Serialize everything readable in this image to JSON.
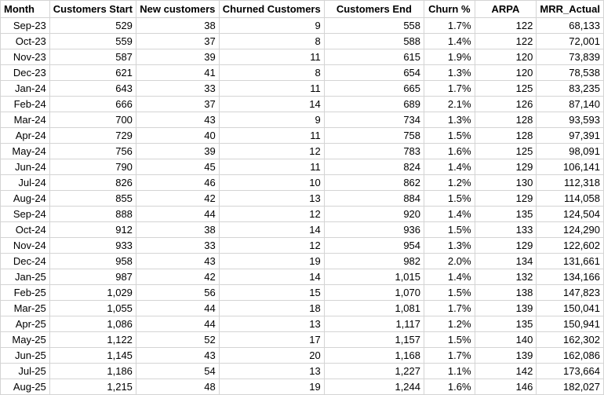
{
  "table": {
    "headers": [
      "Month",
      "Customers Start",
      "New customers",
      "Churned Customers",
      "Customers End",
      "Churn %",
      "ARPA",
      "MRR_Actual"
    ],
    "rows": [
      [
        "Sep-23",
        "529",
        "38",
        "9",
        "558",
        "1.7%",
        "122",
        "68,133"
      ],
      [
        "Oct-23",
        "559",
        "37",
        "8",
        "588",
        "1.4%",
        "122",
        "72,001"
      ],
      [
        "Nov-23",
        "587",
        "39",
        "11",
        "615",
        "1.9%",
        "120",
        "73,839"
      ],
      [
        "Dec-23",
        "621",
        "41",
        "8",
        "654",
        "1.3%",
        "120",
        "78,538"
      ],
      [
        "Jan-24",
        "643",
        "33",
        "11",
        "665",
        "1.7%",
        "125",
        "83,235"
      ],
      [
        "Feb-24",
        "666",
        "37",
        "14",
        "689",
        "2.1%",
        "126",
        "87,140"
      ],
      [
        "Mar-24",
        "700",
        "43",
        "9",
        "734",
        "1.3%",
        "128",
        "93,593"
      ],
      [
        "Apr-24",
        "729",
        "40",
        "11",
        "758",
        "1.5%",
        "128",
        "97,391"
      ],
      [
        "May-24",
        "756",
        "39",
        "12",
        "783",
        "1.6%",
        "125",
        "98,091"
      ],
      [
        "Jun-24",
        "790",
        "45",
        "11",
        "824",
        "1.4%",
        "129",
        "106,141"
      ],
      [
        "Jul-24",
        "826",
        "46",
        "10",
        "862",
        "1.2%",
        "130",
        "112,318"
      ],
      [
        "Aug-24",
        "855",
        "42",
        "13",
        "884",
        "1.5%",
        "129",
        "114,058"
      ],
      [
        "Sep-24",
        "888",
        "44",
        "12",
        "920",
        "1.4%",
        "135",
        "124,504"
      ],
      [
        "Oct-24",
        "912",
        "38",
        "14",
        "936",
        "1.5%",
        "133",
        "124,290"
      ],
      [
        "Nov-24",
        "933",
        "33",
        "12",
        "954",
        "1.3%",
        "129",
        "122,602"
      ],
      [
        "Dec-24",
        "958",
        "43",
        "19",
        "982",
        "2.0%",
        "134",
        "131,661"
      ],
      [
        "Jan-25",
        "987",
        "42",
        "14",
        "1,015",
        "1.4%",
        "132",
        "134,166"
      ],
      [
        "Feb-25",
        "1,029",
        "56",
        "15",
        "1,070",
        "1.5%",
        "138",
        "147,823"
      ],
      [
        "Mar-25",
        "1,055",
        "44",
        "18",
        "1,081",
        "1.7%",
        "139",
        "150,041"
      ],
      [
        "Apr-25",
        "1,086",
        "44",
        "13",
        "1,117",
        "1.2%",
        "135",
        "150,941"
      ],
      [
        "May-25",
        "1,122",
        "52",
        "17",
        "1,157",
        "1.5%",
        "140",
        "162,302"
      ],
      [
        "Jun-25",
        "1,145",
        "43",
        "20",
        "1,168",
        "1.7%",
        "139",
        "162,086"
      ],
      [
        "Jul-25",
        "1,186",
        "54",
        "13",
        "1,227",
        "1.1%",
        "142",
        "173,664"
      ],
      [
        "Aug-25",
        "1,215",
        "48",
        "19",
        "1,244",
        "1.6%",
        "146",
        "182,027"
      ]
    ]
  }
}
